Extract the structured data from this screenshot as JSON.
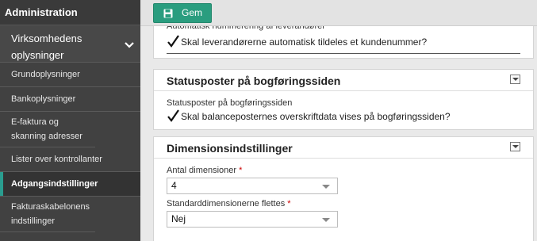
{
  "sidebar": {
    "header": "Administration",
    "section_title": "Virksomhedens oplysninger",
    "items": [
      {
        "label": "Grundoplysninger"
      },
      {
        "label": "Bankoplysninger"
      },
      {
        "label": "E-faktura og skanning adresser"
      },
      {
        "label": "Lister over kontrollanter"
      },
      {
        "label": "Adgangsindstillinger",
        "active": true
      },
      {
        "label": "Fakturaskabelonens indstillinger"
      }
    ]
  },
  "toolbar": {
    "save_label": "Gem",
    "save_icon": "floppy-disk-icon",
    "accent": "#2a9d7f"
  },
  "panels": {
    "auto_numbering": {
      "label": "Automatisk nummerering af leverandører",
      "checkbox_label": "Skal leverandørerne automatisk tildeles et kundenummer?",
      "checked": true
    },
    "status": {
      "title": "Statusposter på bogføringssiden",
      "label": "Statusposter på bogføringssiden",
      "checkbox_label": "Skal balanceposternes overskriftdata vises på bogføringssiden?",
      "checked": true
    },
    "dimensions": {
      "title": "Dimensionsindstillinger",
      "count_label": "Antal dimensioner",
      "count_value": "4",
      "merge_label": "Standarddimensionerne flettes",
      "merge_value": "Nej",
      "required_mark": "*"
    }
  }
}
